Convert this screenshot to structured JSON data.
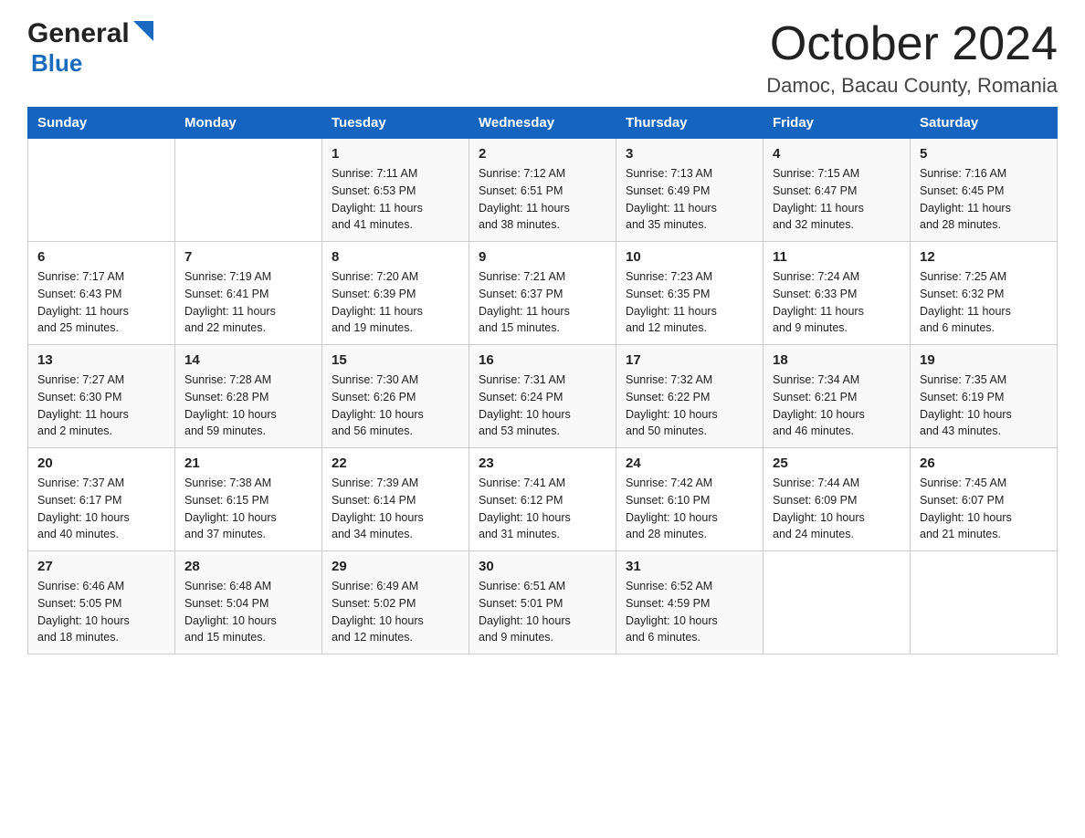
{
  "header": {
    "logo_text_general": "General",
    "logo_text_blue": "Blue",
    "month_title": "October 2024",
    "location": "Damoc, Bacau County, Romania"
  },
  "calendar": {
    "weekdays": [
      "Sunday",
      "Monday",
      "Tuesday",
      "Wednesday",
      "Thursday",
      "Friday",
      "Saturday"
    ],
    "weeks": [
      [
        {
          "day": "",
          "info": ""
        },
        {
          "day": "",
          "info": ""
        },
        {
          "day": "1",
          "info": "Sunrise: 7:11 AM\nSunset: 6:53 PM\nDaylight: 11 hours\nand 41 minutes."
        },
        {
          "day": "2",
          "info": "Sunrise: 7:12 AM\nSunset: 6:51 PM\nDaylight: 11 hours\nand 38 minutes."
        },
        {
          "day": "3",
          "info": "Sunrise: 7:13 AM\nSunset: 6:49 PM\nDaylight: 11 hours\nand 35 minutes."
        },
        {
          "day": "4",
          "info": "Sunrise: 7:15 AM\nSunset: 6:47 PM\nDaylight: 11 hours\nand 32 minutes."
        },
        {
          "day": "5",
          "info": "Sunrise: 7:16 AM\nSunset: 6:45 PM\nDaylight: 11 hours\nand 28 minutes."
        }
      ],
      [
        {
          "day": "6",
          "info": "Sunrise: 7:17 AM\nSunset: 6:43 PM\nDaylight: 11 hours\nand 25 minutes."
        },
        {
          "day": "7",
          "info": "Sunrise: 7:19 AM\nSunset: 6:41 PM\nDaylight: 11 hours\nand 22 minutes."
        },
        {
          "day": "8",
          "info": "Sunrise: 7:20 AM\nSunset: 6:39 PM\nDaylight: 11 hours\nand 19 minutes."
        },
        {
          "day": "9",
          "info": "Sunrise: 7:21 AM\nSunset: 6:37 PM\nDaylight: 11 hours\nand 15 minutes."
        },
        {
          "day": "10",
          "info": "Sunrise: 7:23 AM\nSunset: 6:35 PM\nDaylight: 11 hours\nand 12 minutes."
        },
        {
          "day": "11",
          "info": "Sunrise: 7:24 AM\nSunset: 6:33 PM\nDaylight: 11 hours\nand 9 minutes."
        },
        {
          "day": "12",
          "info": "Sunrise: 7:25 AM\nSunset: 6:32 PM\nDaylight: 11 hours\nand 6 minutes."
        }
      ],
      [
        {
          "day": "13",
          "info": "Sunrise: 7:27 AM\nSunset: 6:30 PM\nDaylight: 11 hours\nand 2 minutes."
        },
        {
          "day": "14",
          "info": "Sunrise: 7:28 AM\nSunset: 6:28 PM\nDaylight: 10 hours\nand 59 minutes."
        },
        {
          "day": "15",
          "info": "Sunrise: 7:30 AM\nSunset: 6:26 PM\nDaylight: 10 hours\nand 56 minutes."
        },
        {
          "day": "16",
          "info": "Sunrise: 7:31 AM\nSunset: 6:24 PM\nDaylight: 10 hours\nand 53 minutes."
        },
        {
          "day": "17",
          "info": "Sunrise: 7:32 AM\nSunset: 6:22 PM\nDaylight: 10 hours\nand 50 minutes."
        },
        {
          "day": "18",
          "info": "Sunrise: 7:34 AM\nSunset: 6:21 PM\nDaylight: 10 hours\nand 46 minutes."
        },
        {
          "day": "19",
          "info": "Sunrise: 7:35 AM\nSunset: 6:19 PM\nDaylight: 10 hours\nand 43 minutes."
        }
      ],
      [
        {
          "day": "20",
          "info": "Sunrise: 7:37 AM\nSunset: 6:17 PM\nDaylight: 10 hours\nand 40 minutes."
        },
        {
          "day": "21",
          "info": "Sunrise: 7:38 AM\nSunset: 6:15 PM\nDaylight: 10 hours\nand 37 minutes."
        },
        {
          "day": "22",
          "info": "Sunrise: 7:39 AM\nSunset: 6:14 PM\nDaylight: 10 hours\nand 34 minutes."
        },
        {
          "day": "23",
          "info": "Sunrise: 7:41 AM\nSunset: 6:12 PM\nDaylight: 10 hours\nand 31 minutes."
        },
        {
          "day": "24",
          "info": "Sunrise: 7:42 AM\nSunset: 6:10 PM\nDaylight: 10 hours\nand 28 minutes."
        },
        {
          "day": "25",
          "info": "Sunrise: 7:44 AM\nSunset: 6:09 PM\nDaylight: 10 hours\nand 24 minutes."
        },
        {
          "day": "26",
          "info": "Sunrise: 7:45 AM\nSunset: 6:07 PM\nDaylight: 10 hours\nand 21 minutes."
        }
      ],
      [
        {
          "day": "27",
          "info": "Sunrise: 6:46 AM\nSunset: 5:05 PM\nDaylight: 10 hours\nand 18 minutes."
        },
        {
          "day": "28",
          "info": "Sunrise: 6:48 AM\nSunset: 5:04 PM\nDaylight: 10 hours\nand 15 minutes."
        },
        {
          "day": "29",
          "info": "Sunrise: 6:49 AM\nSunset: 5:02 PM\nDaylight: 10 hours\nand 12 minutes."
        },
        {
          "day": "30",
          "info": "Sunrise: 6:51 AM\nSunset: 5:01 PM\nDaylight: 10 hours\nand 9 minutes."
        },
        {
          "day": "31",
          "info": "Sunrise: 6:52 AM\nSunset: 4:59 PM\nDaylight: 10 hours\nand 6 minutes."
        },
        {
          "day": "",
          "info": ""
        },
        {
          "day": "",
          "info": ""
        }
      ]
    ]
  }
}
